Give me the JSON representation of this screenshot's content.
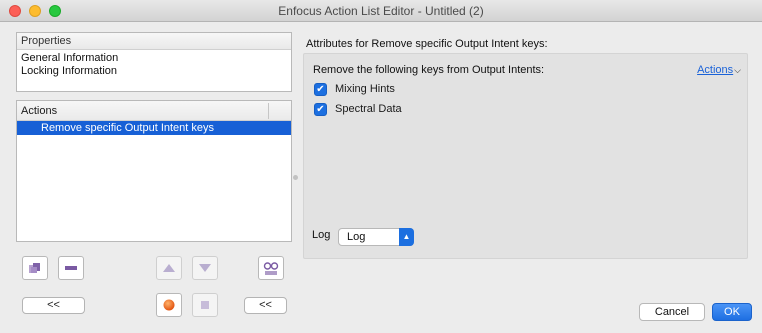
{
  "window": {
    "title": "Enfocus Action List Editor - Untitled (2)"
  },
  "properties": {
    "header": "Properties",
    "items": [
      "General Information",
      "Locking Information"
    ]
  },
  "actions_list": {
    "header": "Actions",
    "items": [
      "Remove specific Output Intent keys"
    ]
  },
  "toolbar": {
    "add_icon": "add-action-icon",
    "remove_icon": "minus-icon",
    "up_icon": "arrow-up-icon",
    "down_icon": "arrow-down-icon",
    "preview_icon": "glasses-icon",
    "run_icon": "orange-ball-icon",
    "stop_icon": "stop-icon",
    "collapse_left_label": "<<",
    "collapse_mid_label": "<<"
  },
  "attributes": {
    "title": "Attributes for Remove specific Output Intent keys:",
    "remove_label": "Remove the following keys from Output Intents:",
    "actions_link": "Actions",
    "checkboxes": [
      {
        "label": "Mixing Hints",
        "checked": true
      },
      {
        "label": "Spectral Data",
        "checked": true
      }
    ],
    "log_label": "Log",
    "log_value": "Log"
  },
  "footer": {
    "cancel_label": "Cancel",
    "ok_label": "OK"
  },
  "colors": {
    "accent": "#1760d6",
    "link": "#1a62d8"
  }
}
